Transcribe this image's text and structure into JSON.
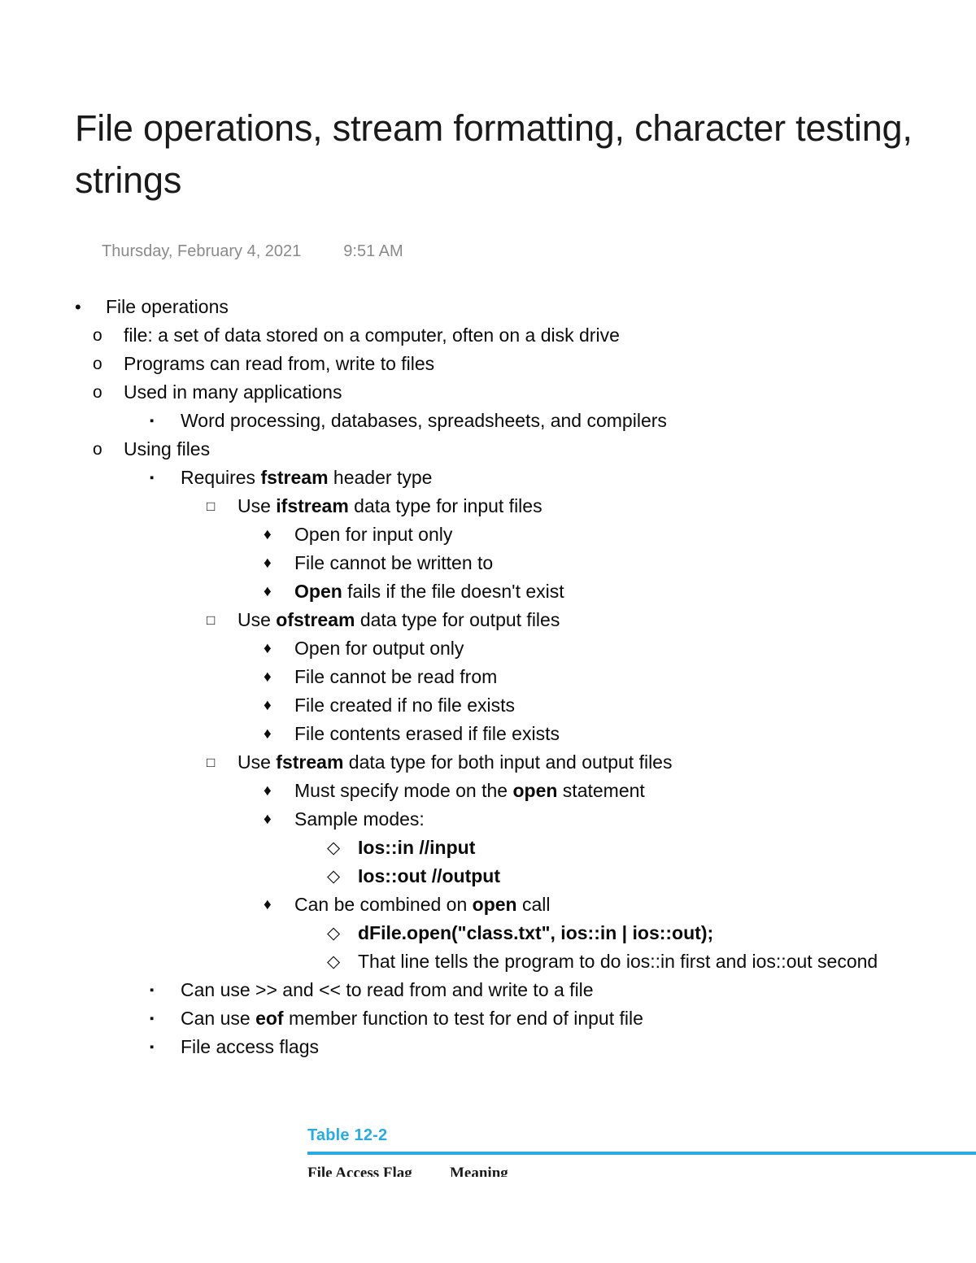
{
  "document": {
    "title": "File operations, stream formatting, character testing, strings",
    "date": "Thursday, February 4, 2021",
    "time": "9:51 AM"
  },
  "markers": {
    "dot": "•",
    "circle": "o",
    "square": "▪",
    "hollow_square": "□",
    "diamond": "♦",
    "hollow_diamond": "◇"
  },
  "outline": [
    {
      "level": 0,
      "marker": "dot",
      "text": "File operations"
    },
    {
      "level": 1,
      "marker": "circle",
      "text": "file: a set of data stored on a computer, often on a disk drive"
    },
    {
      "level": 1,
      "marker": "circle",
      "text": "Programs can read from, write to files"
    },
    {
      "level": 1,
      "marker": "circle",
      "text": "Used in many applications"
    },
    {
      "level": 2,
      "marker": "square",
      "text": "Word processing, databases, spreadsheets, and compilers"
    },
    {
      "level": 1,
      "marker": "circle",
      "text": "Using files"
    },
    {
      "level": 2,
      "marker": "square",
      "text": "Requires fstream header type",
      "bold": [
        "fstream"
      ]
    },
    {
      "level": 3,
      "marker": "hollow_square",
      "text": "Use ifstream data type for input files",
      "bold": [
        "ifstream"
      ]
    },
    {
      "level": 4,
      "marker": "diamond",
      "text": "Open for input only"
    },
    {
      "level": 4,
      "marker": "diamond",
      "text": "File cannot be written to"
    },
    {
      "level": 4,
      "marker": "diamond",
      "text": "Open fails if the file doesn't exist",
      "bold": [
        "Open"
      ]
    },
    {
      "level": 3,
      "marker": "hollow_square",
      "text": "Use ofstream data type for output files",
      "bold": [
        "ofstream"
      ]
    },
    {
      "level": 4,
      "marker": "diamond",
      "text": "Open for output only"
    },
    {
      "level": 4,
      "marker": "diamond",
      "text": "File cannot be read from"
    },
    {
      "level": 4,
      "marker": "diamond",
      "text": "File created if no file exists"
    },
    {
      "level": 4,
      "marker": "diamond",
      "text": "File contents erased if file exists"
    },
    {
      "level": 3,
      "marker": "hollow_square",
      "text": "Use fstream data type for both input and output files",
      "bold": [
        "fstream"
      ]
    },
    {
      "level": 4,
      "marker": "diamond",
      "text": "Must specify mode on the open statement",
      "bold": [
        "open"
      ]
    },
    {
      "level": 4,
      "marker": "diamond",
      "text": "Sample modes:"
    },
    {
      "level": 5,
      "marker": "hollow_diamond",
      "text": "Ios::in //input",
      "all_bold": true
    },
    {
      "level": 5,
      "marker": "hollow_diamond",
      "text": "Ios::out //output",
      "all_bold": true
    },
    {
      "level": 4,
      "marker": "diamond",
      "text": "Can be combined on open call",
      "bold": [
        "open"
      ]
    },
    {
      "level": 5,
      "marker": "hollow_diamond",
      "text": "dFile.open(\"class.txt\", ios::in | ios::out);",
      "all_bold": true
    },
    {
      "level": 5,
      "marker": "hollow_diamond",
      "text": "That line tells the program to do ios::in first and ios::out second"
    },
    {
      "level": 2,
      "marker": "square",
      "text": "Can use >> and << to read from and write to a file"
    },
    {
      "level": 2,
      "marker": "square",
      "text": "Can use eof member function to test for end of input file",
      "bold": [
        "eof"
      ]
    },
    {
      "level": 2,
      "marker": "square",
      "text": "File access flags"
    }
  ],
  "figure": {
    "caption": "Table 12-2",
    "columns": [
      "File Access Flag",
      "Meaning"
    ],
    "accent_color": "#29abe2"
  }
}
